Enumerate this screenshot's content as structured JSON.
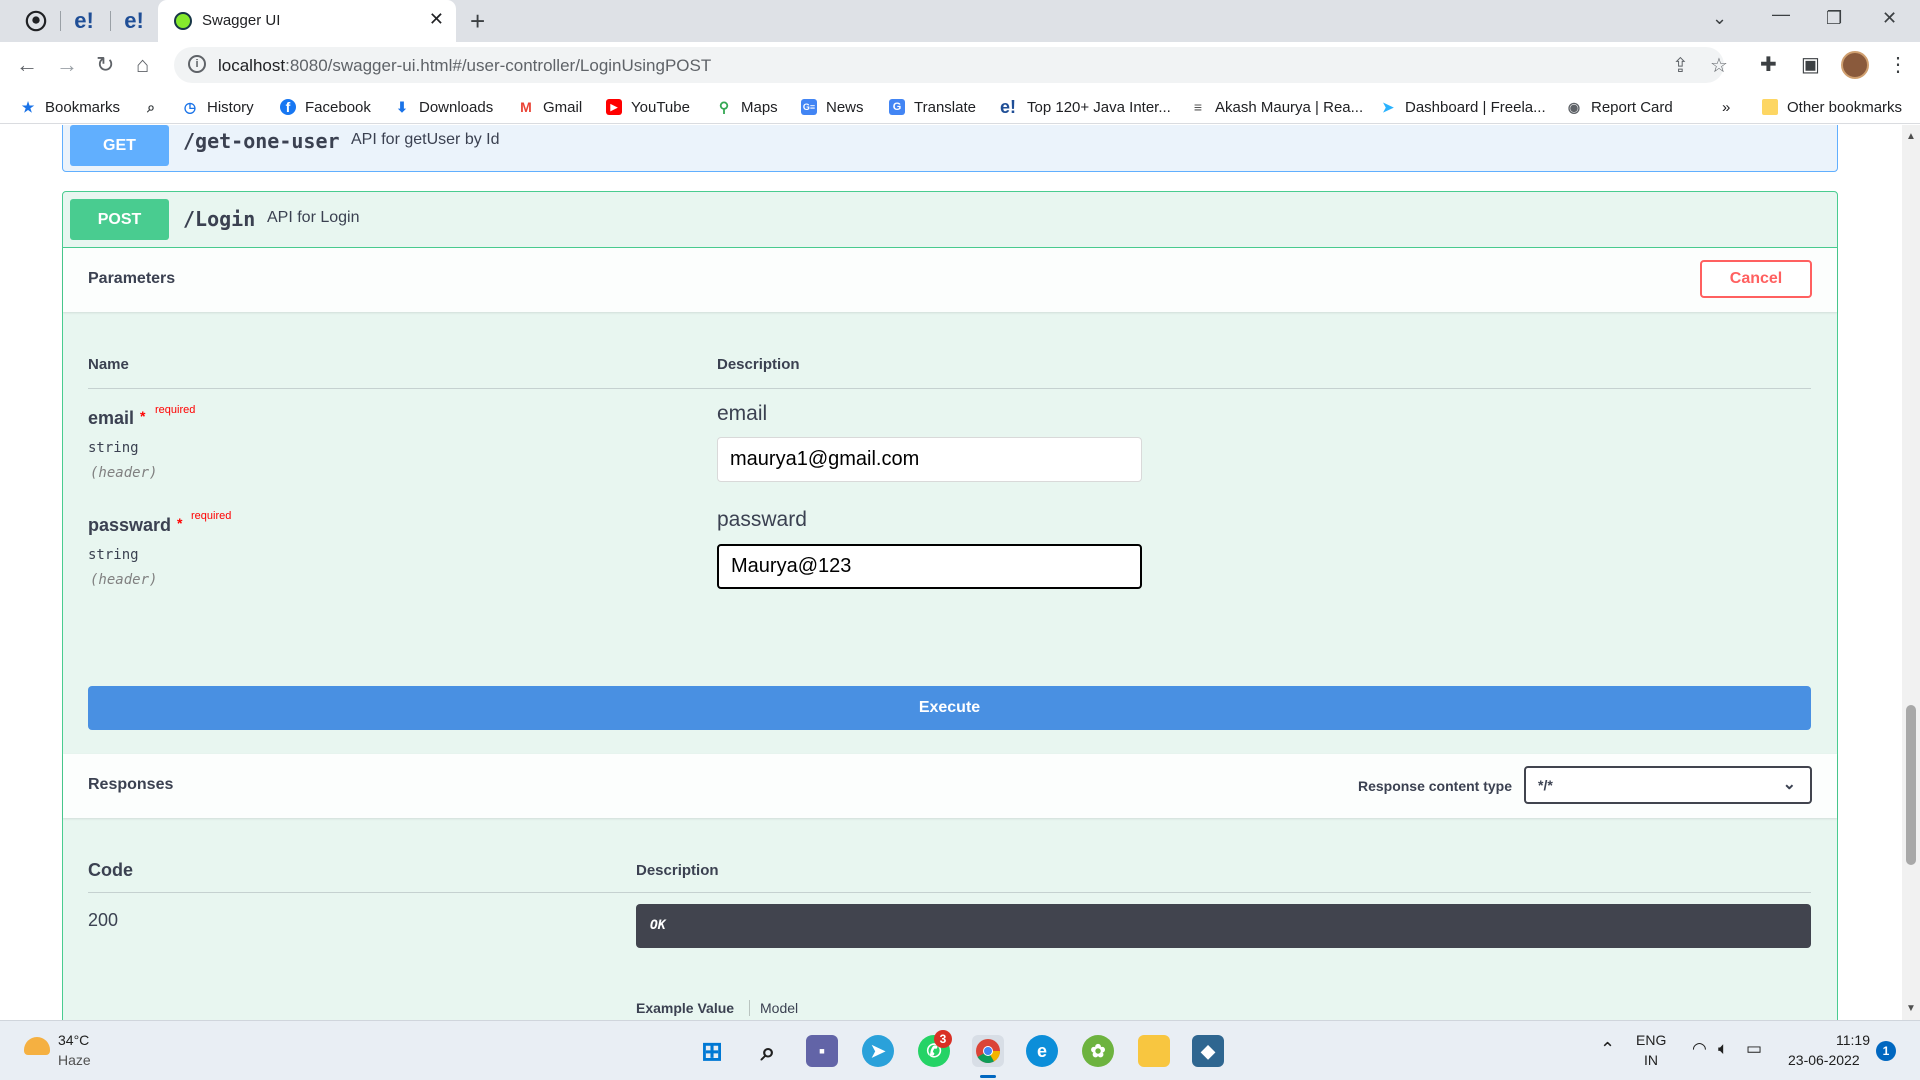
{
  "browser": {
    "pinned_tabs": [
      "e!",
      "e!"
    ],
    "active_tab": {
      "title": "Swagger UI"
    },
    "url_host": "localhost",
    "url_rest": ":8080/swagger-ui.html#/user-controller/LoginUsingPOST",
    "bookmarks": [
      {
        "label": "Bookmarks",
        "icon": "star-icon",
        "color": "#1a73e8"
      },
      {
        "label": "History",
        "icon": "history-icon",
        "color": "#1a73e8"
      },
      {
        "label": "Facebook",
        "icon": "facebook-icon",
        "color": "#1877f2"
      },
      {
        "label": "Downloads",
        "icon": "download-icon",
        "color": "#1a73e8"
      },
      {
        "label": "Gmail",
        "icon": "gmail-icon",
        "color": "#ea4335"
      },
      {
        "label": "YouTube",
        "icon": "youtube-icon",
        "color": "#ff0000"
      },
      {
        "label": "Maps",
        "icon": "maps-icon",
        "color": "#34a853"
      },
      {
        "label": "News",
        "icon": "news-icon",
        "color": "#4285f4"
      },
      {
        "label": "Translate",
        "icon": "translate-icon",
        "color": "#4285f4"
      },
      {
        "label": "Top 120+ Java Inter...",
        "icon": "e-icon",
        "color": "#1f4e96"
      },
      {
        "label": "Akash Maurya | Rea...",
        "icon": "lines-icon",
        "color": "#555555"
      },
      {
        "label": "Dashboard | Freela...",
        "icon": "freelancer-icon",
        "color": "#29b2fe"
      },
      {
        "label": "Report Card",
        "icon": "globe-icon",
        "color": "#5f6368"
      }
    ],
    "bookmarks_overflow": "»",
    "other_bookmarks": "Other bookmarks"
  },
  "swagger": {
    "get_op": {
      "method": "GET",
      "path": "/get-one-user",
      "summary": "API for getUser by Id"
    },
    "post_op": {
      "method": "POST",
      "path": "/Login",
      "summary": "API for Login"
    },
    "parameters_title": "Parameters",
    "cancel_label": "Cancel",
    "col_name": "Name",
    "col_description": "Description",
    "params": [
      {
        "name": "email",
        "required": "required",
        "type": "string",
        "in": "(header)",
        "label": "email",
        "value": "maurya1@gmail.com"
      },
      {
        "name": "passward",
        "required": "required",
        "type": "string",
        "in": "(header)",
        "label": "passward",
        "value": "Maurya@123"
      }
    ],
    "execute_label": "Execute",
    "responses_title": "Responses",
    "response_content_type_label": "Response content type",
    "response_content_type_value": "*/*",
    "col_code": "Code",
    "responses": [
      {
        "code": "200",
        "description": "OK"
      }
    ],
    "example_value_tab": "Example Value",
    "model_tab": "Model",
    "example_snippet": "{"
  },
  "taskbar": {
    "weather_temp": "34°C",
    "weather_desc": "Haze",
    "whatsapp_badge": "3",
    "lang_top": "ENG",
    "lang_bottom": "IN",
    "time": "11:19",
    "date": "23-06-2022",
    "notifications": "1"
  },
  "colors": {
    "get": "#61affe",
    "post": "#49cc90",
    "execute": "#4990e2",
    "cancel": "#ff6060"
  }
}
